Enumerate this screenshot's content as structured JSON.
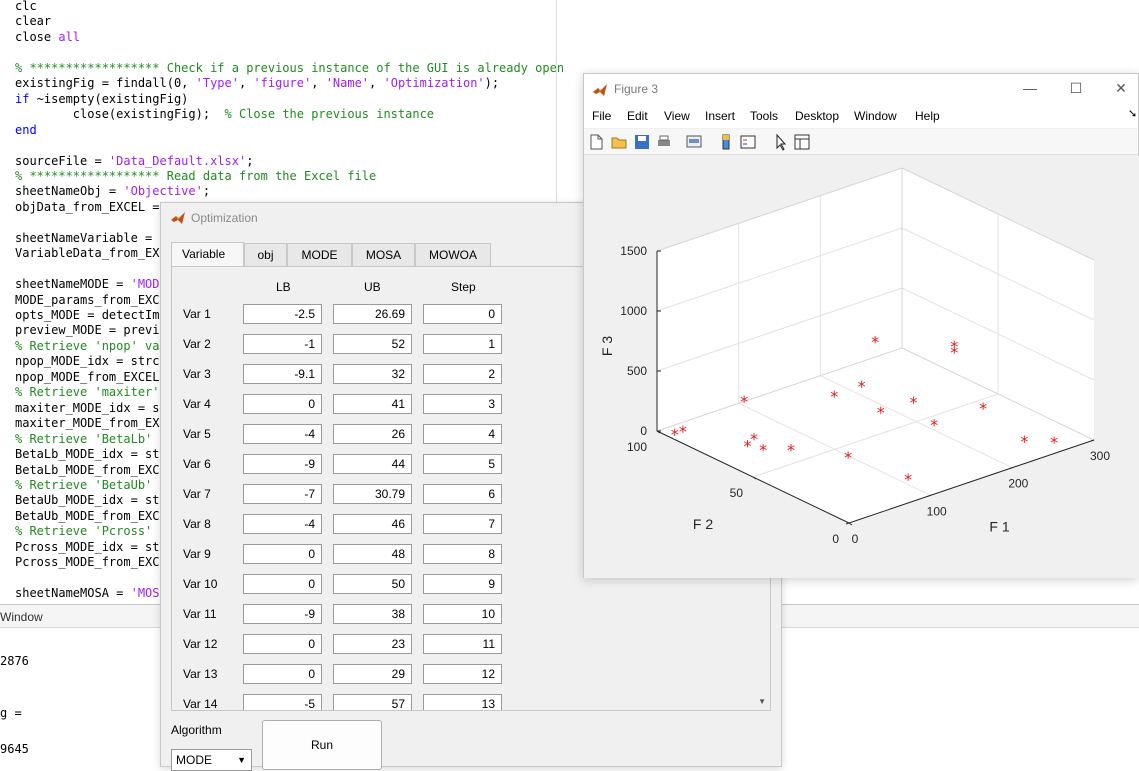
{
  "editor": {
    "lines": [
      [
        {
          "t": "clc",
          "c": ""
        }
      ],
      [
        {
          "t": "clear",
          "c": ""
        }
      ],
      [
        {
          "t": "close ",
          "c": ""
        },
        {
          "t": "all",
          "c": "st"
        }
      ],
      [
        {
          "t": "",
          "c": ""
        }
      ],
      [
        {
          "t": "% ****************** Check if a previous instance of the GUI is already open",
          "c": "cm"
        }
      ],
      [
        {
          "t": "existingFig = findall(0, ",
          "c": ""
        },
        {
          "t": "'Type'",
          "c": "st"
        },
        {
          "t": ", ",
          "c": ""
        },
        {
          "t": "'figure'",
          "c": "st"
        },
        {
          "t": ", ",
          "c": ""
        },
        {
          "t": "'Name'",
          "c": "st"
        },
        {
          "t": ", ",
          "c": ""
        },
        {
          "t": "'Optimization'",
          "c": "st"
        },
        {
          "t": ");",
          "c": ""
        }
      ],
      [
        {
          "t": "if",
          "c": "kw"
        },
        {
          "t": " ~isempty(existingFig)",
          "c": ""
        }
      ],
      [
        {
          "t": "        close(existingFig);  ",
          "c": ""
        },
        {
          "t": "% Close the previous instance",
          "c": "cm"
        }
      ],
      [
        {
          "t": "end",
          "c": "kw"
        }
      ],
      [
        {
          "t": "",
          "c": ""
        }
      ],
      [
        {
          "t": "sourceFile = ",
          "c": ""
        },
        {
          "t": "'Data_Default.xlsx'",
          "c": "st"
        },
        {
          "t": ";",
          "c": ""
        }
      ],
      [
        {
          "t": "% ****************** Read data from the Excel file",
          "c": "cm"
        }
      ],
      [
        {
          "t": "sheetNameObj = ",
          "c": ""
        },
        {
          "t": "'Objective'",
          "c": "st"
        },
        {
          "t": ";",
          "c": ""
        }
      ],
      [
        {
          "t": "objData_from_EXCEL = ",
          "c": ""
        }
      ],
      [
        {
          "t": "",
          "c": ""
        }
      ],
      [
        {
          "t": "sheetNameVariable = ",
          "c": ""
        }
      ],
      [
        {
          "t": "VariableData_from_EX",
          "c": ""
        }
      ],
      [
        {
          "t": "",
          "c": ""
        }
      ],
      [
        {
          "t": "sheetNameMODE = ",
          "c": ""
        },
        {
          "t": "'MOD",
          "c": "st"
        }
      ],
      [
        {
          "t": "MODE_params_from_EXC",
          "c": ""
        }
      ],
      [
        {
          "t": "opts_MODE = detectIm",
          "c": ""
        }
      ],
      [
        {
          "t": "preview_MODE = previ",
          "c": ""
        }
      ],
      [
        {
          "t": "% Retrieve 'npop' va",
          "c": "cm"
        }
      ],
      [
        {
          "t": "npop_MODE_idx = strc",
          "c": ""
        }
      ],
      [
        {
          "t": "npop_MODE_from_EXCEL",
          "c": ""
        }
      ],
      [
        {
          "t": "% Retrieve 'maxiter'",
          "c": "cm"
        }
      ],
      [
        {
          "t": "maxiter_MODE_idx = s",
          "c": ""
        }
      ],
      [
        {
          "t": "maxiter_MODE_from_EX",
          "c": ""
        }
      ],
      [
        {
          "t": "% Retrieve 'BetaLb'",
          "c": "cm"
        }
      ],
      [
        {
          "t": "BetaLb_MODE_idx = st",
          "c": ""
        }
      ],
      [
        {
          "t": "BetaLb_MODE_from_EXC",
          "c": ""
        }
      ],
      [
        {
          "t": "% Retrieve 'BetaUb'",
          "c": "cm"
        }
      ],
      [
        {
          "t": "BetaUb_MODE_idx = st",
          "c": ""
        }
      ],
      [
        {
          "t": "BetaUb_MODE_from_EXC",
          "c": ""
        }
      ],
      [
        {
          "t": "% Retrieve 'Pcross'",
          "c": "cm"
        }
      ],
      [
        {
          "t": "Pcross_MODE_idx = st",
          "c": ""
        }
      ],
      [
        {
          "t": "Pcross_MODE_from_EXC",
          "c": ""
        }
      ],
      [
        {
          "t": "",
          "c": ""
        }
      ],
      [
        {
          "t": "sheetNameMOSA = ",
          "c": ""
        },
        {
          "t": "'MOS",
          "c": "st"
        }
      ]
    ]
  },
  "command_window": {
    "header": "Window",
    "lines": [
      "2876",
      "",
      "",
      "g =",
      "",
      "9645"
    ]
  },
  "optimization": {
    "title": "Optimization",
    "tabs": [
      "Variable",
      "obj",
      "MODE",
      "MOSA",
      "MOWOA"
    ],
    "columns": [
      "LB",
      "UB",
      "Step"
    ],
    "rows": [
      {
        "name": "Var 1",
        "lb": "-2.5",
        "ub": "26.69",
        "step": "0"
      },
      {
        "name": "Var 2",
        "lb": "-1",
        "ub": "52",
        "step": "1"
      },
      {
        "name": "Var 3",
        "lb": "-9.1",
        "ub": "32",
        "step": "2"
      },
      {
        "name": "Var 4",
        "lb": "0",
        "ub": "41",
        "step": "3"
      },
      {
        "name": "Var 5",
        "lb": "-4",
        "ub": "26",
        "step": "4"
      },
      {
        "name": "Var 6",
        "lb": "-9",
        "ub": "44",
        "step": "5"
      },
      {
        "name": "Var 7",
        "lb": "-7",
        "ub": "30.79",
        "step": "6"
      },
      {
        "name": "Var 8",
        "lb": "-4",
        "ub": "46",
        "step": "7"
      },
      {
        "name": "Var 9",
        "lb": "0",
        "ub": "48",
        "step": "8"
      },
      {
        "name": "Var 10",
        "lb": "0",
        "ub": "50",
        "step": "9"
      },
      {
        "name": "Var 11",
        "lb": "-9",
        "ub": "38",
        "step": "10"
      },
      {
        "name": "Var 12",
        "lb": "0",
        "ub": "23",
        "step": "11"
      },
      {
        "name": "Var 13",
        "lb": "0",
        "ub": "29",
        "step": "12"
      },
      {
        "name": "Var 14",
        "lb": "-5",
        "ub": "57",
        "step": "13"
      }
    ],
    "algorithm_label": "Algorithm",
    "algorithm_value": "MODE",
    "run_label": "Run"
  },
  "figure": {
    "title": "Figure 3",
    "menu": [
      "File",
      "Edit",
      "View",
      "Insert",
      "Tools",
      "Desktop",
      "Window",
      "Help"
    ],
    "toolbar_icons": [
      "new-file-icon",
      "open-folder-icon",
      "save-icon",
      "print-icon",
      "print-preview-icon",
      "colorbar-icon",
      "legend-icon",
      "pointer-icon",
      "property-inspector-icon"
    ]
  },
  "chart_data": {
    "type": "scatter",
    "dimensions": 3,
    "xlabel": "F 1",
    "ylabel": "F 2",
    "zlabel": "F 3",
    "xlim": [
      0,
      300
    ],
    "ylim": [
      0,
      100
    ],
    "zlim": [
      0,
      1500
    ],
    "xticks": [
      "0",
      "100",
      "200",
      "300"
    ],
    "yticks": [
      "0",
      "50",
      "100"
    ],
    "zticks": [
      "0",
      "500",
      "1000",
      "1500"
    ],
    "marker": "*",
    "marker_color": "#e41a1c",
    "grid": true,
    "points": [
      {
        "x": 10,
        "y": 95,
        "z": 0
      },
      {
        "x": 20,
        "y": 95,
        "z": 0
      },
      {
        "x": 45,
        "y": 72,
        "z": 0
      },
      {
        "x": 50,
        "y": 66,
        "z": 0
      },
      {
        "x": 60,
        "y": 75,
        "z": 0
      },
      {
        "x": 70,
        "y": 60,
        "z": 0
      },
      {
        "x": 110,
        "y": 16,
        "z": 0
      },
      {
        "x": 100,
        "y": 43,
        "z": 0
      },
      {
        "x": 55,
        "y": 78,
        "z": 300
      },
      {
        "x": 210,
        "y": 45,
        "z": 0
      },
      {
        "x": 270,
        "y": 45,
        "z": 0
      },
      {
        "x": 250,
        "y": 15,
        "z": 0
      },
      {
        "x": 270,
        "y": 8,
        "z": 0
      },
      {
        "x": 180,
        "y": 60,
        "z": 60
      },
      {
        "x": 170,
        "y": 80,
        "z": 60
      },
      {
        "x": 180,
        "y": 70,
        "z": 200
      },
      {
        "x": 220,
        "y": 60,
        "z": 50
      },
      {
        "x": 220,
        "y": 80,
        "z": 400
      },
      {
        "x": 270,
        "y": 60,
        "z": 400
      },
      {
        "x": 270,
        "y": 60,
        "z": 350
      }
    ]
  }
}
